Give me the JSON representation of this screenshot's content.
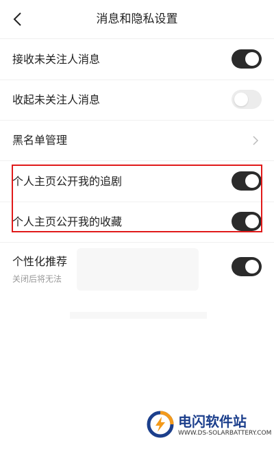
{
  "header": {
    "title": "消息和隐私设置"
  },
  "rows": [
    {
      "label": "接收未关注人消息",
      "toggle": "on"
    },
    {
      "label": "收起未关注人消息",
      "toggle": "off"
    },
    {
      "label": "黑名单管理"
    },
    {
      "label": "个人主页公开我的追剧",
      "toggle": "on"
    },
    {
      "label": "个人主页公开我的收藏",
      "toggle": "on"
    }
  ],
  "personalized": {
    "label": "个性化推荐",
    "subtitle": "关闭后将无法",
    "toggle": "on"
  },
  "watermark": {
    "title": "电闪软件站",
    "url": "WWW.DS-SOLARBATTERY.COM"
  },
  "colors": {
    "toggle_on": "#2b2b2b",
    "toggle_off": "#ececec",
    "highlight_border": "#e01919",
    "watermark_blue": "#1c3f8c",
    "watermark_orange": "#f39a1b"
  }
}
